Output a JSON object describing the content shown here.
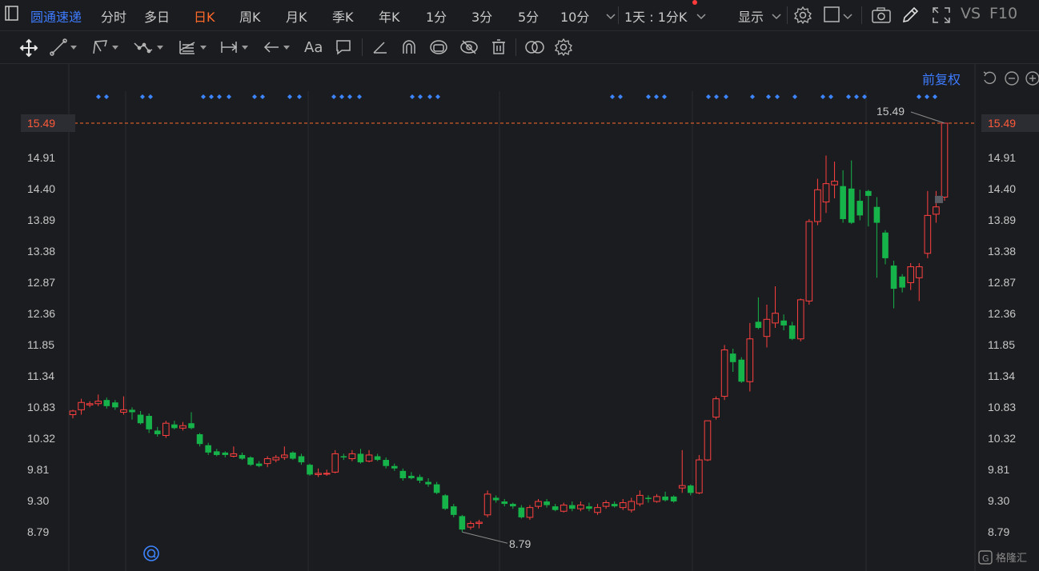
{
  "topbar": {
    "stock_name": "圆通速递",
    "tabs": [
      "分时",
      "多日",
      "日K",
      "周K",
      "月K",
      "季K",
      "年K",
      "1分",
      "3分",
      "5分",
      "10分"
    ],
    "active_tab": "日K",
    "period_select": "1天 : 1分K",
    "display_label": "显示",
    "vs_label": "VS",
    "f10_label": "F10"
  },
  "toolbar": {
    "text_tool": "Aa"
  },
  "chart": {
    "fuquan_label": "前复权",
    "current_price": "15.49",
    "high_annotation": "15.49",
    "low_annotation": "8.79",
    "y_ticks": [
      "14.91",
      "14.40",
      "13.89",
      "13.38",
      "12.87",
      "12.36",
      "11.85",
      "11.34",
      "10.83",
      "10.32",
      "9.81",
      "9.30",
      "8.79"
    ],
    "colors": {
      "up": "#ff4040",
      "down": "#16b34a",
      "accent": "#ff6a2b",
      "link": "#3d7bff",
      "marker": "#3d85ff"
    }
  },
  "chart_data": {
    "type": "candlestick",
    "ylim": [
      8.4,
      15.9
    ],
    "candles": [
      [
        10.72,
        10.78,
        10.8,
        10.66
      ],
      [
        10.8,
        10.92,
        10.98,
        10.72
      ],
      [
        10.88,
        10.9,
        10.94,
        10.84
      ],
      [
        10.9,
        10.94,
        11.05,
        10.86
      ],
      [
        10.96,
        10.86,
        11.0,
        10.82
      ],
      [
        10.92,
        10.84,
        10.96,
        10.8
      ],
      [
        10.76,
        10.8,
        11.02,
        10.72
      ],
      [
        10.8,
        10.76,
        10.84,
        10.64
      ],
      [
        10.72,
        10.58,
        10.78,
        10.56
      ],
      [
        10.7,
        10.48,
        10.74,
        10.42
      ],
      [
        10.46,
        10.4,
        10.52,
        10.36
      ],
      [
        10.38,
        10.58,
        10.62,
        10.34
      ],
      [
        10.56,
        10.5,
        10.62,
        10.48
      ],
      [
        10.5,
        10.54,
        10.6,
        10.46
      ],
      [
        10.58,
        10.5,
        10.76,
        10.48
      ],
      [
        10.4,
        10.24,
        10.42,
        10.2
      ],
      [
        10.22,
        10.1,
        10.26,
        10.06
      ],
      [
        10.12,
        10.06,
        10.16,
        10.04
      ],
      [
        10.1,
        10.06,
        10.12,
        10.02
      ],
      [
        10.04,
        10.08,
        10.2,
        10.02
      ],
      [
        10.06,
        10.0,
        10.1,
        9.98
      ],
      [
        10.02,
        9.9,
        10.04,
        9.88
      ],
      [
        9.92,
        9.88,
        9.96,
        9.86
      ],
      [
        9.92,
        10.0,
        10.04,
        9.86
      ],
      [
        9.98,
        10.02,
        10.06,
        9.94
      ],
      [
        10.02,
        10.06,
        10.2,
        9.98
      ],
      [
        10.1,
        10.0,
        10.12,
        9.98
      ],
      [
        10.04,
        9.94,
        10.08,
        9.9
      ],
      [
        9.9,
        9.74,
        9.92,
        9.72
      ],
      [
        9.74,
        9.76,
        9.84,
        9.7
      ],
      [
        9.76,
        9.76,
        9.82,
        9.72
      ],
      [
        9.78,
        10.08,
        10.14,
        9.76
      ],
      [
        10.04,
        10.02,
        10.08,
        9.98
      ],
      [
        10.0,
        10.08,
        10.14,
        9.96
      ],
      [
        10.08,
        9.94,
        10.16,
        9.92
      ],
      [
        9.96,
        10.06,
        10.14,
        9.94
      ],
      [
        10.04,
        9.98,
        10.08,
        9.96
      ],
      [
        9.98,
        9.88,
        10.02,
        9.84
      ],
      [
        9.88,
        9.84,
        9.92,
        9.8
      ],
      [
        9.8,
        9.68,
        9.84,
        9.64
      ],
      [
        9.72,
        9.68,
        9.78,
        9.66
      ],
      [
        9.7,
        9.64,
        9.74,
        9.6
      ],
      [
        9.62,
        9.58,
        9.68,
        9.54
      ],
      [
        9.58,
        9.44,
        9.62,
        9.42
      ],
      [
        9.4,
        9.18,
        9.42,
        9.16
      ],
      [
        9.22,
        9.08,
        9.26,
        9.04
      ],
      [
        9.06,
        8.84,
        9.08,
        8.8
      ],
      [
        8.88,
        8.94,
        8.98,
        8.84
      ],
      [
        8.94,
        8.96,
        9.0,
        8.86
      ],
      [
        9.08,
        9.42,
        9.48,
        9.04
      ],
      [
        9.36,
        9.32,
        9.4,
        9.28
      ],
      [
        9.3,
        9.26,
        9.34,
        9.22
      ],
      [
        9.26,
        9.22,
        9.28,
        9.18
      ],
      [
        9.2,
        9.04,
        9.24,
        9.02
      ],
      [
        9.04,
        9.2,
        9.24,
        9.0
      ],
      [
        9.22,
        9.3,
        9.34,
        9.18
      ],
      [
        9.3,
        9.24,
        9.34,
        9.2
      ],
      [
        9.22,
        9.16,
        9.26,
        9.14
      ],
      [
        9.14,
        9.24,
        9.28,
        9.12
      ],
      [
        9.24,
        9.18,
        9.3,
        9.14
      ],
      [
        9.18,
        9.24,
        9.3,
        9.14
      ],
      [
        9.22,
        9.18,
        9.28,
        9.14
      ],
      [
        9.12,
        9.2,
        9.26,
        9.08
      ],
      [
        9.22,
        9.28,
        9.32,
        9.18
      ],
      [
        9.26,
        9.22,
        9.3,
        9.2
      ],
      [
        9.2,
        9.28,
        9.34,
        9.16
      ],
      [
        9.16,
        9.3,
        9.36,
        9.12
      ],
      [
        9.26,
        9.4,
        9.48,
        9.22
      ],
      [
        9.36,
        9.34,
        9.4,
        9.28
      ],
      [
        9.3,
        9.38,
        9.42,
        9.28
      ],
      [
        9.38,
        9.32,
        9.46,
        9.3
      ],
      [
        9.38,
        9.3,
        9.4,
        9.28
      ],
      [
        9.52,
        9.56,
        10.14,
        9.44
      ],
      [
        9.56,
        9.44,
        9.58,
        9.4
      ],
      [
        9.44,
        9.98,
        10.06,
        9.42
      ],
      [
        9.98,
        10.62,
        10.62,
        9.96
      ],
      [
        10.68,
        10.98,
        11.02,
        10.64
      ],
      [
        11.02,
        11.78,
        11.86,
        10.96
      ],
      [
        11.72,
        11.58,
        11.8,
        11.42
      ],
      [
        11.62,
        11.26,
        11.66,
        11.24
      ],
      [
        11.26,
        11.96,
        12.22,
        11.1
      ],
      [
        12.24,
        12.14,
        12.64,
        12.12
      ],
      [
        12.0,
        12.28,
        12.52,
        11.82
      ],
      [
        12.22,
        12.38,
        12.82,
        12.14
      ],
      [
        12.26,
        12.18,
        12.36,
        12.1
      ],
      [
        12.18,
        11.96,
        12.24,
        11.94
      ],
      [
        11.96,
        12.6,
        12.62,
        11.92
      ],
      [
        12.58,
        13.88,
        13.92,
        12.52
      ],
      [
        13.88,
        14.4,
        14.58,
        13.82
      ],
      [
        14.2,
        14.5,
        14.96,
        14.02
      ],
      [
        14.48,
        14.54,
        14.86,
        14.26
      ],
      [
        14.46,
        13.92,
        14.72,
        13.86
      ],
      [
        14.42,
        13.86,
        14.88,
        13.84
      ],
      [
        14.22,
        13.98,
        14.4,
        13.9
      ],
      [
        14.38,
        14.3,
        14.4,
        13.8
      ],
      [
        14.12,
        13.86,
        14.28,
        12.96
      ],
      [
        13.7,
        13.28,
        13.74,
        13.18
      ],
      [
        13.16,
        12.78,
        13.24,
        12.46
      ],
      [
        12.98,
        12.8,
        13.02,
        12.72
      ],
      [
        12.88,
        13.14,
        13.2,
        12.76
      ],
      [
        12.96,
        13.14,
        13.2,
        12.58
      ],
      [
        13.36,
        13.98,
        14.38,
        13.28
      ],
      [
        14.0,
        14.12,
        14.38,
        13.86
      ],
      [
        14.28,
        15.49,
        15.49,
        14.22
      ]
    ]
  }
}
